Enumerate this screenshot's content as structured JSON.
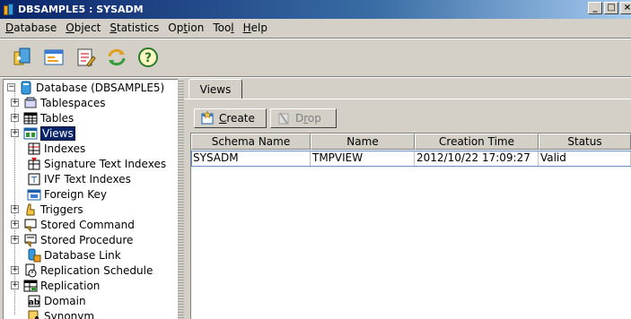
{
  "window": {
    "title": "DBSAMPLE5 : SYSADM",
    "btn_min": "_",
    "btn_max": "□",
    "btn_close": "×"
  },
  "menu": [
    {
      "pre": "",
      "key": "D",
      "post": "atabase"
    },
    {
      "pre": "",
      "key": "O",
      "post": "bject"
    },
    {
      "pre": "",
      "key": "S",
      "post": "tatistics"
    },
    {
      "pre": "Op",
      "key": "t",
      "post": "ion"
    },
    {
      "pre": "Too",
      "key": "l",
      "post": ""
    },
    {
      "pre": "",
      "key": "H",
      "post": "elp"
    }
  ],
  "toolbar_icons": [
    "connect-icon",
    "properties-icon",
    "edit-icon",
    "refresh-icon",
    "help-icon"
  ],
  "tree": {
    "root": "Database (DBSAMPLE5)",
    "items": [
      {
        "label": "Tablespaces",
        "icon": "tablespaces-icon",
        "expandable": true
      },
      {
        "label": "Tables",
        "icon": "tables-icon",
        "expandable": true
      },
      {
        "label": "Views",
        "icon": "views-icon",
        "expandable": true,
        "selected": true
      },
      {
        "label": "Indexes",
        "icon": "indexes-icon",
        "expandable": false
      },
      {
        "label": "Signature Text Indexes",
        "icon": "signature-index-icon",
        "expandable": false
      },
      {
        "label": "IVF Text Indexes",
        "icon": "ivf-index-icon",
        "expandable": false
      },
      {
        "label": "Foreign Key",
        "icon": "foreign-key-icon",
        "expandable": false
      },
      {
        "label": "Triggers",
        "icon": "triggers-icon",
        "expandable": true
      },
      {
        "label": "Stored Command",
        "icon": "stored-command-icon",
        "expandable": true
      },
      {
        "label": "Stored Procedure",
        "icon": "stored-procedure-icon",
        "expandable": true
      },
      {
        "label": "Database Link",
        "icon": "database-link-icon",
        "expandable": false
      },
      {
        "label": "Replication Schedule",
        "icon": "replication-schedule-icon",
        "expandable": true
      },
      {
        "label": "Replication",
        "icon": "replication-icon",
        "expandable": true
      },
      {
        "label": "Domain",
        "icon": "domain-icon",
        "expandable": false
      },
      {
        "label": "Synonym",
        "icon": "synonym-icon",
        "expandable": false
      }
    ]
  },
  "tabs": [
    {
      "label": "Views"
    }
  ],
  "actions": {
    "create": {
      "key": "C",
      "rest": "reate"
    },
    "drop": {
      "pre": "D",
      "key": "r",
      "post": "op"
    }
  },
  "table": {
    "columns": [
      "Schema Name",
      "Name",
      "Creation Time",
      "Status"
    ],
    "rows": [
      [
        "SYSADM",
        "TMPVIEW",
        "2012/10/22 17:09:27",
        "Valid"
      ]
    ]
  }
}
